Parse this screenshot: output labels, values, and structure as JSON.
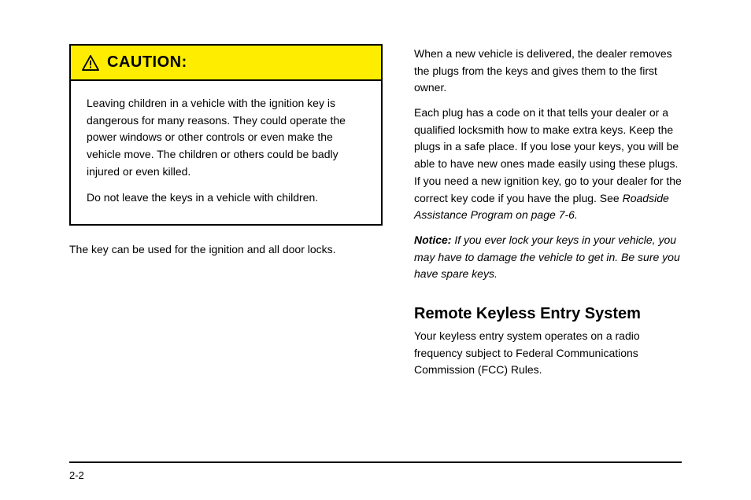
{
  "caution": {
    "header_label": "CAUTION:",
    "paragraphs": [
      "Leaving children in a vehicle with the ignition key is dangerous for many reasons. They could operate the power windows or other controls or even make the vehicle move. The children or others could be badly injured or even killed.",
      "Do not leave the keys in a vehicle with children."
    ]
  },
  "left_body": {
    "p1": "The key can be used for the ignition and all door locks."
  },
  "right_body": {
    "p1": "When a new vehicle is delivered, the dealer removes the plugs from the keys and gives them to the first owner.",
    "p2_prefix": "Each plug has a code on it that tells your dealer or a qualified locksmith how to make extra keys. Keep the plugs in a safe place. If you lose your keys, you will be able to have new ones made easily using these plugs. If you need a new ignition key, go to your dealer for the correct key code if you have the plug. See ",
    "p2_link": "Roadside Assistance Program on page 7-6.",
    "heading_notice": "Notice:",
    "p3_after_heading": " If you ever lock your keys in your vehicle, you may have to damage the vehicle to get in. Be sure you have spare keys."
  },
  "section": {
    "heading": "Remote Keyless Entry System",
    "p1": "Your keyless entry system operates on a radio frequency subject to Federal Communications Commission (FCC) Rules."
  },
  "footer": {
    "page_number": "2-2"
  }
}
